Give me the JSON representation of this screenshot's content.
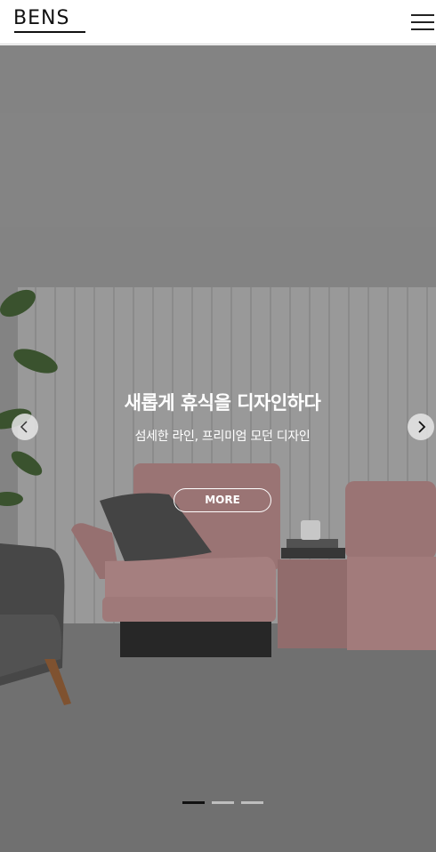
{
  "header": {
    "logo_text": "BENS",
    "menu_icon": "hamburger-menu-icon"
  },
  "hero": {
    "title": "새롭게 휴식을 디자인하다",
    "subtitle": "섬세한 라인, 프리미엄 모던 디자인",
    "more_label": "MORE",
    "prev_icon": "chevron-left-icon",
    "next_icon": "chevron-right-icon",
    "slides_total": 3,
    "active_slide": 1
  },
  "colors": {
    "sofa": "#b88a8a",
    "wall": "#8e8e8e",
    "floor": "#7d7d7d",
    "accent": "#111111"
  }
}
